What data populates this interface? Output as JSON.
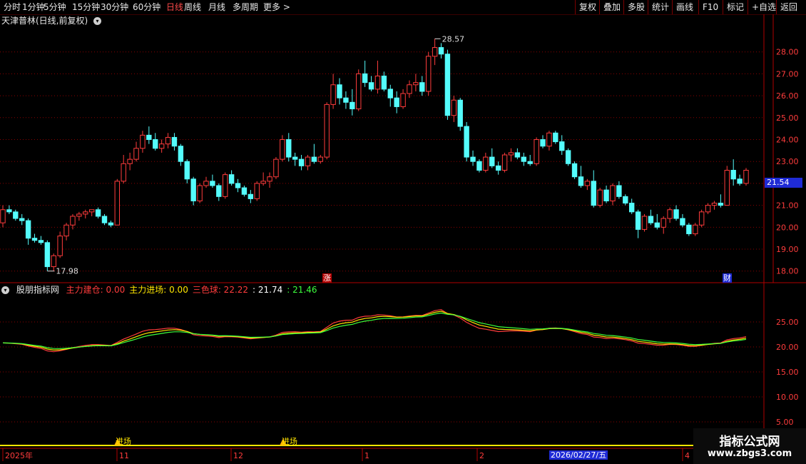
{
  "toolbar": {
    "periods": [
      "分时",
      "1分钟",
      "5分钟",
      "15分钟",
      "30分钟",
      "60分钟",
      "日线",
      "周线",
      "月线",
      "多周期",
      "更多 >"
    ],
    "active_period": "日线",
    "right_buttons": [
      "复权",
      "叠加",
      "多股",
      "统计",
      "画线",
      "F10",
      "标记",
      "+自选",
      "返回"
    ]
  },
  "title": {
    "stock": "天津普林(日线,前复权)",
    "dropdown_icon": "chevron-down-icon"
  },
  "main_chart": {
    "high_label": "28.57",
    "low_label": "17.98",
    "current_price": "21.54",
    "price_axis": [
      "28.00",
      "27.00",
      "26.00",
      "25.00",
      "24.00",
      "23.00",
      "22.00",
      "21.00",
      "20.00",
      "19.00",
      "18.00"
    ],
    "markers": {
      "zhang": "涨",
      "cai": "财"
    },
    "colors": {
      "up": "#ff3c3c",
      "down": "#54fcfc",
      "grid": "#8b0000"
    }
  },
  "indicator": {
    "name": "股朋指标网",
    "values": [
      {
        "text": "主力建仓: 0.00",
        "color": "#ff3c3c"
      },
      {
        "text": "主力进场: 0.00",
        "color": "#ffe600"
      },
      {
        "text": "三色球: 22.22",
        "color": "#ff3c3c"
      },
      {
        "text": ": 21.74",
        "color": "#ffffff"
      },
      {
        "text": ": 21.46",
        "color": "#3cff3c"
      }
    ],
    "axis": [
      "25.00",
      "20.00",
      "15.00",
      "10.00",
      "5.00"
    ],
    "signals": [
      "进场",
      "进场"
    ]
  },
  "date_axis": {
    "labels": [
      "2025年",
      "11",
      "12",
      "1",
      "2",
      "4"
    ],
    "cursor_date": "2026/02/27/五"
  },
  "watermark": {
    "title": "指标公式网",
    "url": "www.zbgs3.com"
  },
  "chart_data": {
    "type": "candlestick",
    "ohlc": [
      [
        20.2,
        21.0,
        20.0,
        20.8
      ],
      [
        20.8,
        21.0,
        20.6,
        20.7
      ],
      [
        20.7,
        20.8,
        20.3,
        20.4
      ],
      [
        20.4,
        20.6,
        20.1,
        20.3
      ],
      [
        20.3,
        20.4,
        19.2,
        19.5
      ],
      [
        19.5,
        19.7,
        19.3,
        19.4
      ],
      [
        19.4,
        19.6,
        19.2,
        19.3
      ],
      [
        19.3,
        19.4,
        18.0,
        18.2
      ],
      [
        18.2,
        18.8,
        18.0,
        18.7
      ],
      [
        18.7,
        19.8,
        18.6,
        19.6
      ],
      [
        19.6,
        20.2,
        19.4,
        20.1
      ],
      [
        20.1,
        20.6,
        19.9,
        20.5
      ],
      [
        20.5,
        20.7,
        20.3,
        20.6
      ],
      [
        20.6,
        20.8,
        20.4,
        20.7
      ],
      [
        20.7,
        20.8,
        20.5,
        20.8
      ],
      [
        20.8,
        20.9,
        20.4,
        20.5
      ],
      [
        20.5,
        20.6,
        20.1,
        20.2
      ],
      [
        20.2,
        20.3,
        20.0,
        20.1
      ],
      [
        20.1,
        22.2,
        20.1,
        22.1
      ],
      [
        22.1,
        23.3,
        22.0,
        22.9
      ],
      [
        22.9,
        23.4,
        22.6,
        23.1
      ],
      [
        23.1,
        23.9,
        23.0,
        23.6
      ],
      [
        23.6,
        24.4,
        23.4,
        24.2
      ],
      [
        24.2,
        24.6,
        23.8,
        24.0
      ],
      [
        24.0,
        24.3,
        23.5,
        23.6
      ],
      [
        23.6,
        24.0,
        23.4,
        23.8
      ],
      [
        23.8,
        24.3,
        23.6,
        24.1
      ],
      [
        24.1,
        24.3,
        23.5,
        23.7
      ],
      [
        23.7,
        23.8,
        22.8,
        23.0
      ],
      [
        23.0,
        23.1,
        22.0,
        22.2
      ],
      [
        22.2,
        22.3,
        21.0,
        21.2
      ],
      [
        21.2,
        22.0,
        21.1,
        21.9
      ],
      [
        21.9,
        22.3,
        21.8,
        22.1
      ],
      [
        22.1,
        22.4,
        21.8,
        21.9
      ],
      [
        21.9,
        22.0,
        21.2,
        21.4
      ],
      [
        21.4,
        22.5,
        21.3,
        22.4
      ],
      [
        22.4,
        22.6,
        21.9,
        22.0
      ],
      [
        22.0,
        22.2,
        21.6,
        21.8
      ],
      [
        21.8,
        21.9,
        21.4,
        21.5
      ],
      [
        21.5,
        21.7,
        21.1,
        21.3
      ],
      [
        21.3,
        22.1,
        21.2,
        22.0
      ],
      [
        22.0,
        22.5,
        21.9,
        22.1
      ],
      [
        22.1,
        22.5,
        21.8,
        22.3
      ],
      [
        22.3,
        23.2,
        22.2,
        23.1
      ],
      [
        23.1,
        24.2,
        23.0,
        24.0
      ],
      [
        24.0,
        24.3,
        23.0,
        23.2
      ],
      [
        23.2,
        23.4,
        22.8,
        23.1
      ],
      [
        23.1,
        23.3,
        22.6,
        22.8
      ],
      [
        22.8,
        23.3,
        22.6,
        23.2
      ],
      [
        23.2,
        23.8,
        22.9,
        23.0
      ],
      [
        23.0,
        23.3,
        22.9,
        23.2
      ],
      [
        23.2,
        25.7,
        23.1,
        25.6
      ],
      [
        25.6,
        27.0,
        25.4,
        26.5
      ],
      [
        26.5,
        26.8,
        25.6,
        25.9
      ],
      [
        25.9,
        26.2,
        25.4,
        25.7
      ],
      [
        25.7,
        26.3,
        25.1,
        25.4
      ],
      [
        25.4,
        27.2,
        25.3,
        27.0
      ],
      [
        27.0,
        27.6,
        26.4,
        26.6
      ],
      [
        26.6,
        26.9,
        26.2,
        26.3
      ],
      [
        26.3,
        27.6,
        26.1,
        26.9
      ],
      [
        26.9,
        27.1,
        26.2,
        26.3
      ],
      [
        26.3,
        26.5,
        25.5,
        25.9
      ],
      [
        25.9,
        26.2,
        25.2,
        25.5
      ],
      [
        25.5,
        26.3,
        25.4,
        26.1
      ],
      [
        26.1,
        26.7,
        25.9,
        26.5
      ],
      [
        26.5,
        27.0,
        26.2,
        26.6
      ],
      [
        26.6,
        26.9,
        26.0,
        26.2
      ],
      [
        26.2,
        28.0,
        26.0,
        27.8
      ],
      [
        27.8,
        28.6,
        27.4,
        28.2
      ],
      [
        28.2,
        28.4,
        27.7,
        27.9
      ],
      [
        27.9,
        28.1,
        24.9,
        25.1
      ],
      [
        25.1,
        26.0,
        24.8,
        25.8
      ],
      [
        25.8,
        25.9,
        24.4,
        24.6
      ],
      [
        24.6,
        24.8,
        23.0,
        23.2
      ],
      [
        23.2,
        23.5,
        22.8,
        23.0
      ],
      [
        23.0,
        23.1,
        22.5,
        22.6
      ],
      [
        22.6,
        23.4,
        22.5,
        23.2
      ],
      [
        23.2,
        23.6,
        22.7,
        22.8
      ],
      [
        22.8,
        23.0,
        22.4,
        22.6
      ],
      [
        22.6,
        23.4,
        22.5,
        23.3
      ],
      [
        23.3,
        23.6,
        23.0,
        23.4
      ],
      [
        23.4,
        23.6,
        23.1,
        23.2
      ],
      [
        23.2,
        23.4,
        22.8,
        23.0
      ],
      [
        23.0,
        23.3,
        22.8,
        22.9
      ],
      [
        22.9,
        24.1,
        22.8,
        24.0
      ],
      [
        24.0,
        24.2,
        23.6,
        23.7
      ],
      [
        23.7,
        24.4,
        23.5,
        24.3
      ],
      [
        24.3,
        24.4,
        23.8,
        23.9
      ],
      [
        23.9,
        24.2,
        23.3,
        23.5
      ],
      [
        23.5,
        23.6,
        22.8,
        22.9
      ],
      [
        22.9,
        23.0,
        22.2,
        22.3
      ],
      [
        22.3,
        22.8,
        21.8,
        21.9
      ],
      [
        21.9,
        22.2,
        21.7,
        22.1
      ],
      [
        22.1,
        22.6,
        20.9,
        21.0
      ],
      [
        21.0,
        21.8,
        20.9,
        21.7
      ],
      [
        21.7,
        21.9,
        21.1,
        21.2
      ],
      [
        21.2,
        22.0,
        21.0,
        21.9
      ],
      [
        21.9,
        22.1,
        21.3,
        21.4
      ],
      [
        21.4,
        21.5,
        21.0,
        21.1
      ],
      [
        21.1,
        21.3,
        20.6,
        20.7
      ],
      [
        20.7,
        20.8,
        19.5,
        19.9
      ],
      [
        19.9,
        20.6,
        19.8,
        20.5
      ],
      [
        20.5,
        20.8,
        20.1,
        20.2
      ],
      [
        20.2,
        20.6,
        19.9,
        20.0
      ],
      [
        20.0,
        20.5,
        19.7,
        20.4
      ],
      [
        20.4,
        20.9,
        20.2,
        20.8
      ],
      [
        20.8,
        21.0,
        20.3,
        20.4
      ],
      [
        20.4,
        20.6,
        20.0,
        20.1
      ],
      [
        20.1,
        20.2,
        19.6,
        19.7
      ],
      [
        19.7,
        20.2,
        19.6,
        20.1
      ],
      [
        20.1,
        20.8,
        20.0,
        20.7
      ],
      [
        20.7,
        21.1,
        20.6,
        21.0
      ],
      [
        21.0,
        21.2,
        20.8,
        21.1
      ],
      [
        21.1,
        21.5,
        20.9,
        21.0
      ],
      [
        21.0,
        22.8,
        21.0,
        22.6
      ],
      [
        22.6,
        23.1,
        21.9,
        22.2
      ],
      [
        22.2,
        22.4,
        21.9,
        22.0
      ],
      [
        22.0,
        22.7,
        21.9,
        22.6
      ]
    ],
    "ylim": [
      17.6,
      29.0
    ],
    "indicator_ylim": [
      0,
      30
    ],
    "indicator_series": [
      {
        "name": "主力建仓",
        "color": "#ff3c3c"
      },
      {
        "name": "主力进场",
        "color": "#ffe600"
      },
      {
        "name": "三色球",
        "color": "#3cff3c"
      }
    ]
  }
}
